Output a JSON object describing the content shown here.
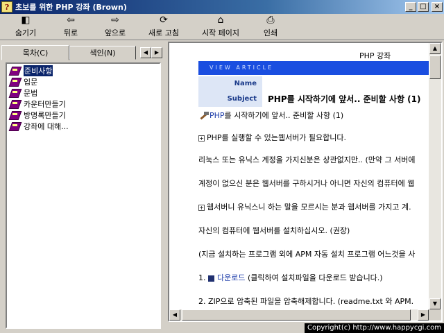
{
  "window": {
    "title": "초보를 위한 PHP 강좌 (Brown)",
    "icon": "help-book-icon"
  },
  "toolbar": {
    "hide": "숨기기",
    "back": "뒤로",
    "forward": "앞으로",
    "refresh": "새로 고침",
    "home": "시작 페이지",
    "print": "인쇄",
    "hide_icon": "◧",
    "back_icon": "⇦",
    "forward_icon": "⇨",
    "refresh_icon": "⟳",
    "home_icon": "⌂",
    "print_icon": "⎙"
  },
  "tabs": {
    "contents": "목차(C)",
    "index": "색인(N)"
  },
  "tree": {
    "items": [
      {
        "label": "준비사항"
      },
      {
        "label": "입문"
      },
      {
        "label": "문법"
      },
      {
        "label": "카운터만들기"
      },
      {
        "label": "방명록만들기"
      },
      {
        "label": "강좌에 대해..."
      }
    ]
  },
  "content": {
    "page_title": "PHP 강좌",
    "bar_label": "VIEW ARTICLE",
    "name_key": "Name",
    "name_value": "",
    "subject_key": "Subject",
    "subject_value": "PHP를 시작하기에 앞서.. 준비할 사항 (1)",
    "intro_link": "PHP",
    "intro_rest": "를 시작하기에 앞서.. 준비할 사항 (1)",
    "p1": "PHP를 실행할 수 있는웹서버가 필요합니다.",
    "p2": "리눅스 또는 유닉스 계정을 가지신분은 상관없지만.. (만약 그 서버에",
    "p3": "계정이 없으신 분은 웹서버를 구하시거나 아니면 자신의 컴퓨터에 웹",
    "p4": "웹서버니 유닉스니 하는 말을 모르시는 분과 웹서버를 가지고 계.",
    "p5": "자신의 컴퓨터에 웹서버를 설치하십시오. (권장)",
    "p6": "(지금 설치하는 프로그램 외에 APM 자동 설치 프로그램 어느것을 사",
    "p7_prefix": "1.",
    "p7_link": "다운로드",
    "p7_rest": "(클릭하여 설치파일을 다운로드 받습니다.)",
    "p8": "2. ZIP으로 압축된 파일을 압축해제합니다. (readme.txt 와 APM."
  },
  "copyright": "Copyright(c) http://www.happycgi.com",
  "colors": {
    "title_start": "#0a246a",
    "title_end": "#a6caf0",
    "article_bar": "#1a4ee0",
    "link": "#1a3aa8"
  }
}
